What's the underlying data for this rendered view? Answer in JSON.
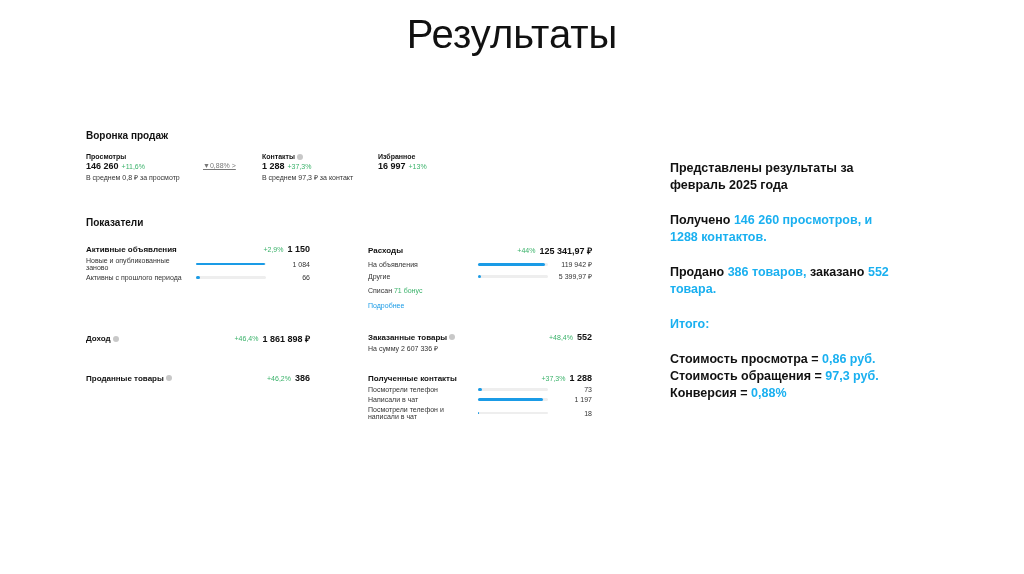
{
  "title": "Результаты",
  "funnel": {
    "heading": "Воронка продаж",
    "items": [
      {
        "kind": "stage",
        "label": "Просмотры",
        "info": false,
        "value": "146 260",
        "change": "+11,6%",
        "note": "В среднем 0,8 ₽ за просмотр"
      },
      {
        "kind": "conversion",
        "value": "▼0,88% >"
      },
      {
        "kind": "stage",
        "label": "Контакты",
        "info": true,
        "value": "1 288",
        "change": "+37,3%",
        "note": "В среднем 97,3 ₽ за контакт"
      },
      {
        "kind": "stage",
        "label": "Избранное",
        "info": false,
        "value": "16 997",
        "change": "+13%"
      }
    ]
  },
  "metrics": {
    "heading": "Показатели",
    "cards": [
      {
        "title": "Активные объявления",
        "info": false,
        "change": "+2,9%",
        "value": "1 150",
        "rows": [
          {
            "label": "Новые и опубликованные заново",
            "level": 0.98,
            "value": "1 084"
          },
          {
            "label": "Активны с прошлого периода",
            "level": 0.06,
            "value": "66"
          }
        ]
      },
      {
        "title": "Расходы",
        "info": false,
        "change": "+44%",
        "value": "125 341,97 ₽",
        "rows": [
          {
            "label": "На объявления",
            "level": 0.95,
            "value": "119 942 ₽"
          },
          {
            "label": "Другие",
            "level": 0.04,
            "value": "5 399,97 ₽"
          }
        ],
        "bonus": [
          {
            "text": "Списан ",
            "accent": false
          },
          {
            "text": "71 бонус",
            "accent": true
          }
        ],
        "link": "Подробнее"
      },
      {
        "title": "Доход",
        "info": true,
        "change": "+46,4%",
        "value": "1 861 898 ₽"
      },
      {
        "title": "Заказанные товары",
        "info": true,
        "change": "+48,4%",
        "value": "552",
        "note": "На сумму 2 607 336 ₽"
      },
      {
        "title": "Проданные товары",
        "info": true,
        "change": "+46,2%",
        "value": "386"
      },
      {
        "title": "Полученные контакты",
        "info": false,
        "change": "+37,3%",
        "value": "1 288",
        "rows": [
          {
            "label": "Посмотрели телефон",
            "level": 0.06,
            "value": "73"
          },
          {
            "label": "Написали в чат",
            "level": 0.93,
            "value": "1 197"
          },
          {
            "label": "Посмотрели телефон и написали в чат",
            "level": 0.02,
            "value": "18"
          }
        ]
      }
    ]
  },
  "summary": [
    {
      "lines": [
        [
          {
            "text": "Представлены результаты за февраль 2025 года",
            "accent": false
          }
        ]
      ]
    },
    {
      "lines": [
        [
          {
            "text": "Получено ",
            "accent": false
          },
          {
            "text": "146 260 просмотров, и 1288 контактов.",
            "accent": true
          }
        ]
      ]
    },
    {
      "lines": [
        [
          {
            "text": "Продано ",
            "accent": false
          },
          {
            "text": "386 товаров, ",
            "accent": true
          },
          {
            "text": "заказано ",
            "accent": false
          },
          {
            "text": "552 товара.",
            "accent": true
          }
        ]
      ]
    },
    {
      "lines": [
        [
          {
            "text": "Итого:",
            "accent": true
          }
        ]
      ]
    },
    {
      "lines": [
        [
          {
            "text": "Стоимость просмотра = ",
            "accent": false
          },
          {
            "text": "0,86 руб.",
            "accent": true
          }
        ],
        [
          {
            "text": "Стоимость обращения = ",
            "accent": false
          },
          {
            "text": "97,3 руб.",
            "accent": true
          }
        ],
        [
          {
            "text": "Конверсия = ",
            "accent": false
          },
          {
            "text": "0,88%",
            "accent": true
          }
        ]
      ]
    }
  ]
}
